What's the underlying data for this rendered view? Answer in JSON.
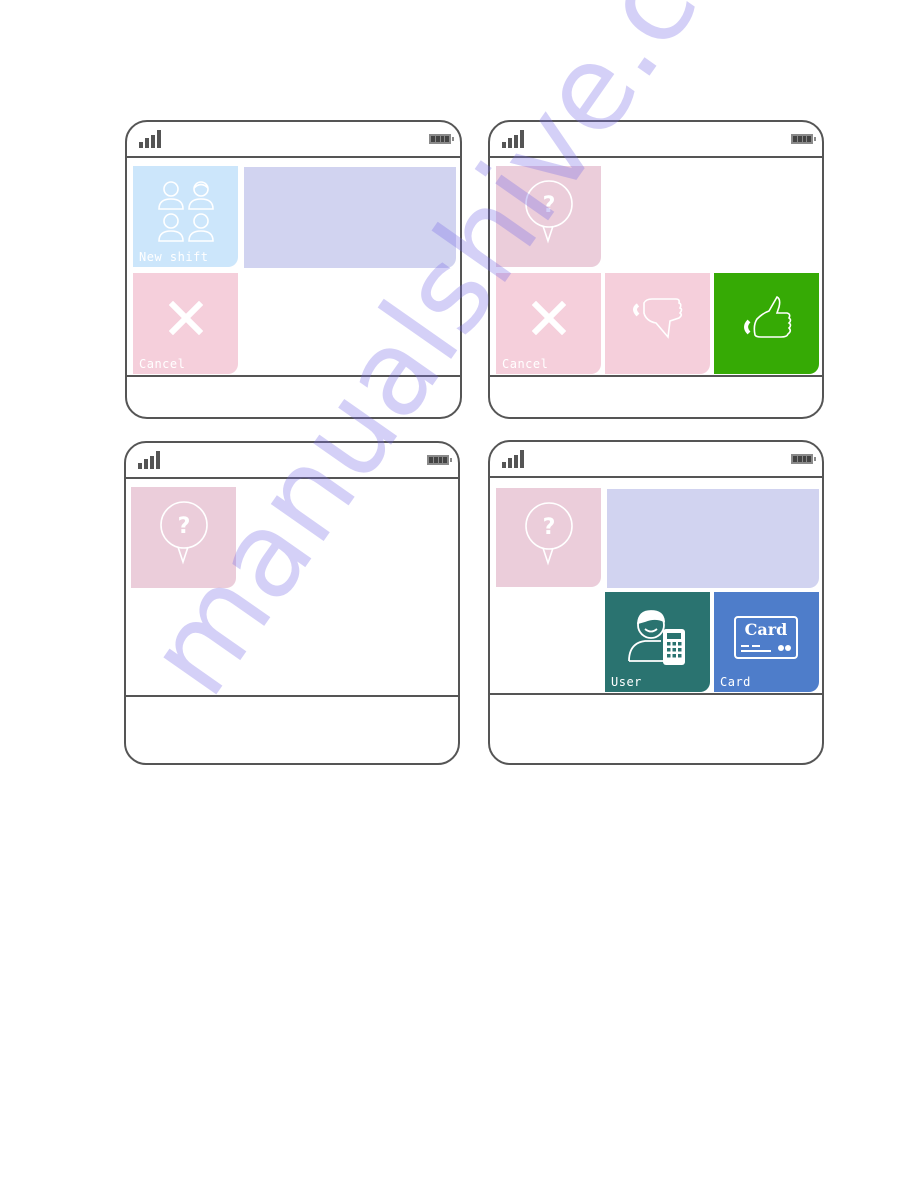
{
  "colors": {
    "frame": "#555555",
    "new_shift_tile": "#cce6fb",
    "info_panel": "#d1d3f0",
    "cancel_tile": "#f5cfdb",
    "help_tile": "#ebcdda",
    "thumbs_down_tile": "#f5cfdb",
    "thumbs_up_tile": "#36aa05",
    "user_tile": "#2a7370",
    "card_tile": "#4e7dca"
  },
  "screens": [
    {
      "id": "screen-1",
      "tiles": [
        {
          "icon": "people-group-icon",
          "label": "New shift"
        },
        {
          "icon": "close-x-icon",
          "label": "Cancel"
        }
      ]
    },
    {
      "id": "screen-2",
      "tiles": [
        {
          "icon": "help-bubble-icon",
          "label": ""
        },
        {
          "icon": "close-x-icon",
          "label": "Cancel"
        },
        {
          "icon": "thumbs-down-icon",
          "label": ""
        },
        {
          "icon": "thumbs-up-icon",
          "label": ""
        }
      ]
    },
    {
      "id": "screen-3",
      "tiles": [
        {
          "icon": "help-bubble-icon",
          "label": ""
        }
      ]
    },
    {
      "id": "screen-4",
      "tiles": [
        {
          "icon": "help-bubble-icon",
          "label": ""
        },
        {
          "icon": "user-terminal-icon",
          "label": "User"
        },
        {
          "icon": "card-icon",
          "label": "Card",
          "icon_text": "Card"
        }
      ]
    }
  ],
  "watermark": "manualshive.com"
}
